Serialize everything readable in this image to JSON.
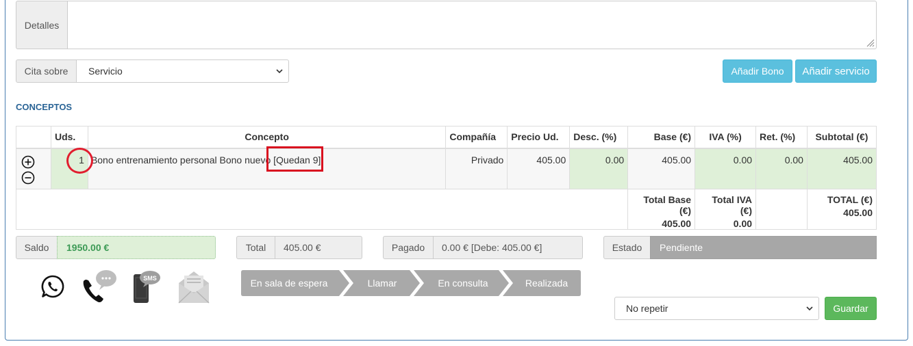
{
  "detalles": {
    "label": "Detalles",
    "value": ""
  },
  "cita": {
    "label": "Cita sobre",
    "selected": "Servicio"
  },
  "buttons": {
    "add_bono": "Añadir Bono",
    "add_servicio": "Añadir servicio",
    "guardar": "Guardar"
  },
  "section_title": "CONCEPTOS",
  "table": {
    "headers": [
      "",
      "Uds.",
      "Concepto",
      "Compañía",
      "Precio Ud.",
      "Desc. (%)",
      "Base (€)",
      "IVA (%)",
      "Ret. (%)",
      "Subtotal (€)"
    ],
    "rows": [
      {
        "uds": "1",
        "concepto": "Bono entrenamiento personal Bono nuevo [Quedan 9]",
        "compania": "Privado",
        "precio": "405.00",
        "desc": "0.00",
        "base": "405.00",
        "iva": "0.00",
        "ret": "0.00",
        "subtotal": "405.00"
      }
    ],
    "totals": {
      "base_label": "Total Base (€)",
      "base_value": "405.00",
      "iva_label": "Total IVA (€)",
      "iva_value": "0.00",
      "total_label": "TOTAL (€)",
      "total_value": "405.00"
    }
  },
  "summary": {
    "saldo_label": "Saldo",
    "saldo_value": "1950.00 €",
    "total_label": "Total",
    "total_value": "405.00 €",
    "pagado_label": "Pagado",
    "pagado_value": "0.00 € [Debe: 405.00 €]",
    "estado_label": "Estado",
    "estado_value": "Pendiente"
  },
  "comm_icons": [
    "whatsapp-icon",
    "phone-chat-icon",
    "sms-icon",
    "email-icon"
  ],
  "sms_badge": "SMS",
  "status_steps": [
    "En sala de espera",
    "Llamar",
    "En consulta",
    "Realizada"
  ],
  "repeat": {
    "selected": "No repetir"
  },
  "colors": {
    "info": "#5bc0de",
    "success": "#5cb85c",
    "section": "#2a6496",
    "highlight_green": "#dff0d8",
    "step_gray": "#a9a9a9",
    "annotation_red": "#e11d2e"
  }
}
